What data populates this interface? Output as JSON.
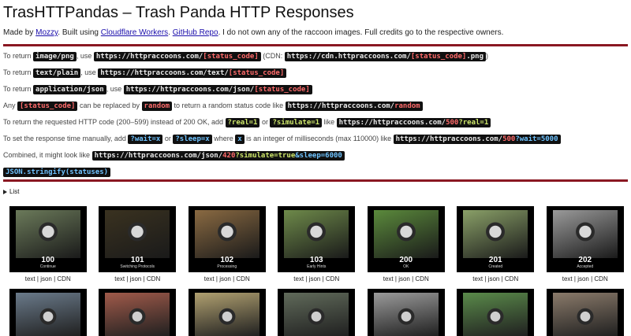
{
  "header": {
    "title": "TrasHTTPandas – Trash Panda HTTP Responses",
    "credits": {
      "made_by": "Made by ",
      "author": "Mozzy",
      "built": ". Built using ",
      "workers": "Cloudflare Workers",
      "sep": ". ",
      "repo": "GitHub Repo",
      "rest": ". I do not own any of the raccoon images. Full credits go to the respective owners."
    }
  },
  "instructions": {
    "l1": {
      "a": "To return ",
      "code1": "image/png",
      "b": ", use ",
      "url_pre": "https://httpraccoons.com/",
      "url_ph": "[status_code]",
      "c": " (CDN: ",
      "cdn_pre": "https://cdn.httpraccoons.com/",
      "cdn_ph": "[status_code]",
      "cdn_post": ".png",
      "d": ")"
    },
    "l2": {
      "a": "To return ",
      "code1": "text/plain",
      "b": ", use ",
      "url_pre": "https://httpraccoons.com/text/",
      "url_ph": "[status_code]"
    },
    "l3": {
      "a": "To return ",
      "code1": "application/json",
      "b": ", use ",
      "url_pre": "https://httpraccoons.com/json/",
      "url_ph": "[status_code]"
    },
    "l4": {
      "a": "Any ",
      "code1": "[status_code]",
      "b": " can be replaced by ",
      "code2": "random",
      "c": " to return a random status code like ",
      "url_pre": "https://httpraccoons.com/",
      "url_ph": "random"
    },
    "l5": {
      "a": "To return the requested HTTP code (200–599) instead of 200 OK, add ",
      "code1": "?real=1",
      "b": " or ",
      "code2": "?simulate=1",
      "c": " like ",
      "url_pre": "https://httpraccoons.com/",
      "url_num": "500",
      "url_q": "?real=1"
    },
    "l6": {
      "a": "To set the response time manually, add ",
      "code1": "?wait=x",
      "b": " or ",
      "code2": "?sleep=x",
      "c": " where ",
      "code3": "x",
      "d": " is an integer of milliseconds (max 110000) like ",
      "url_pre": "https://httpraccoons.com/",
      "url_num": "500",
      "url_q": "?wait=5000"
    },
    "l7": {
      "a": "Combined, it might look like ",
      "url_pre": "https://httpraccoons.com/json/",
      "url_num": "420",
      "url_q1": "?simulate=true",
      "url_q2": "&sleep=6000"
    }
  },
  "json_line": "JSON.stringify(statuses)",
  "list_label": "List",
  "links": {
    "text": "text",
    "json": "json",
    "cdn": "CDN",
    "sep": " | "
  },
  "cards": [
    {
      "code": "100",
      "label": "Continue",
      "color": "#6b7a5a"
    },
    {
      "code": "101",
      "label": "Switching Protocols",
      "color": "#3a3220"
    },
    {
      "code": "102",
      "label": "Processing",
      "color": "#8a6a42"
    },
    {
      "code": "103",
      "label": "Early Hints",
      "color": "#6e8a4a"
    },
    {
      "code": "200",
      "label": "OK",
      "color": "#5b8a3c"
    },
    {
      "code": "201",
      "label": "Created",
      "color": "#8aa068"
    },
    {
      "code": "202",
      "label": "Accepted",
      "color": "#9a9a9a"
    }
  ],
  "row2_colors": [
    "#6a7a8a",
    "#a05a4a",
    "#b0a070",
    "#606a5a",
    "#9a9a9a",
    "#5a8a4a",
    "#8a7a6a"
  ]
}
